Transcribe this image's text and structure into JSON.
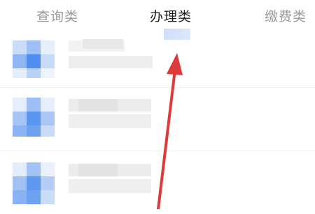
{
  "tabs": [
    {
      "label": "查询类",
      "active": false
    },
    {
      "label": "办理类",
      "active": true
    },
    {
      "label": "缴费类",
      "active": false
    }
  ],
  "colors": {
    "active_tab": "#222222",
    "inactive_tab": "#9a9a9a",
    "icon_blue": "#5b95f0",
    "icon_blue_light": "#b9d1f7",
    "blur_gray": "#e6e6e6",
    "annotation_arrow": "#e0393a"
  },
  "list": {
    "items": [
      {
        "icon": "app-icon-pixelated"
      },
      {
        "icon": "app-icon-pixelated"
      },
      {
        "icon": "app-icon-pixelated"
      }
    ]
  },
  "annotation": {
    "icon": "red-arrow-up"
  }
}
